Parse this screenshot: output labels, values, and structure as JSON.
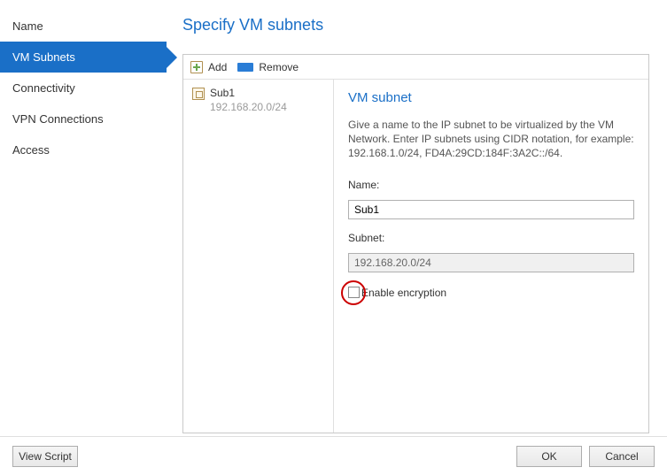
{
  "sidebar": {
    "items": [
      {
        "label": "Name"
      },
      {
        "label": "VM Subnets"
      },
      {
        "label": "Connectivity"
      },
      {
        "label": "VPN Connections"
      },
      {
        "label": "Access"
      }
    ],
    "activeIndex": 1
  },
  "page": {
    "title": "Specify VM subnets"
  },
  "toolbar": {
    "add_label": "Add",
    "remove_label": "Remove"
  },
  "subnet_list": [
    {
      "name": "Sub1",
      "cidr": "192.168.20.0/24"
    }
  ],
  "detail": {
    "section_title": "VM subnet",
    "description": "Give a name to the IP subnet to be virtualized by the VM Network. Enter IP subnets using CIDR notation, for example: 192.168.1.0/24, FD4A:29CD:184F:3A2C::/64.",
    "name_label": "Name:",
    "name_value": "Sub1",
    "subnet_label": "Subnet:",
    "subnet_value": "192.168.20.0/24",
    "encryption_label": "Enable encryption",
    "encryption_checked": false
  },
  "footer": {
    "view_script": "View Script",
    "ok": "OK",
    "cancel": "Cancel"
  }
}
